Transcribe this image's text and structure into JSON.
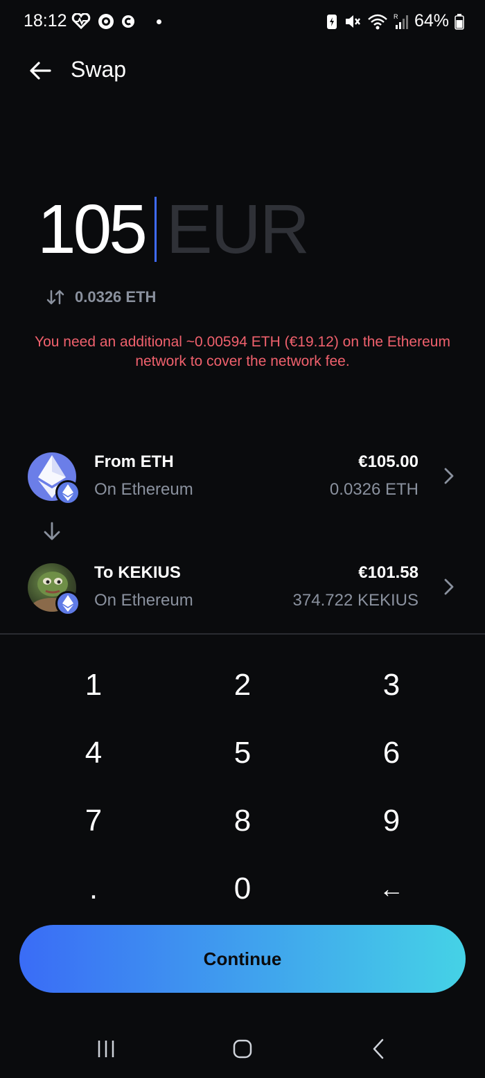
{
  "status_bar": {
    "time": "18:12",
    "battery": "64%",
    "icons": [
      "heart-wave-icon",
      "record-icon",
      "c-icon",
      "dot-icon",
      "battery-saver-icon",
      "mute-icon",
      "wifi-icon",
      "signal-icon",
      "battery-icon"
    ]
  },
  "header": {
    "title": "Swap",
    "back_icon": "arrow-left-icon"
  },
  "amount": {
    "value": "105",
    "currency": "EUR",
    "conversion": "0.0326 ETH",
    "swap_icon": "swap-vertical-icon"
  },
  "warning": "You need an additional ~0.00594 ETH (€19.12) on the Ethereum network to cover the network fee.",
  "from": {
    "title": "From ETH",
    "network": "On Ethereum",
    "fiat": "€105.00",
    "crypto": "0.0326 ETH"
  },
  "to": {
    "title": "To KEKIUS",
    "network": "On Ethereum",
    "fiat": "€101.58",
    "crypto": "374.722 KEKIUS"
  },
  "keypad": {
    "keys": [
      "1",
      "2",
      "3",
      "4",
      "5",
      "6",
      "7",
      "8",
      "9",
      ".",
      "0",
      "←"
    ]
  },
  "continue_label": "Continue",
  "colors": {
    "background": "#0a0b0d",
    "accent_start": "#3a6cf6",
    "accent_end": "#45d2e6",
    "warning": "#f0616d",
    "secondary_text": "#8a919e",
    "caret": "#3f6bff"
  }
}
